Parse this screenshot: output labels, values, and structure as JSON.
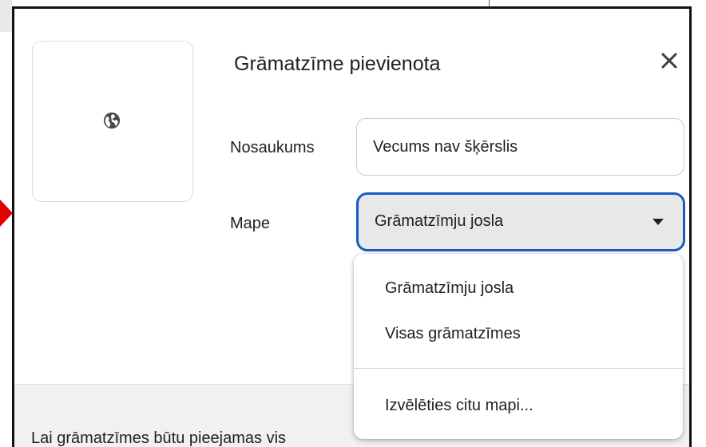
{
  "dialog": {
    "title": "Grāmatzīme pievienota",
    "close_icon": "close-icon",
    "thumbnail_icon": "globe-icon"
  },
  "form": {
    "name_label": "Nosaukums",
    "name_value": "Vecums nav šķērslis",
    "folder_label": "Mape",
    "folder_selected": "Grāmatzīmju josla",
    "folder_caret_icon": "caret-down-icon"
  },
  "folder_menu": {
    "items": [
      {
        "label": "Grāmatzīmju josla"
      },
      {
        "label": "Visas grāmatzīmes"
      }
    ],
    "choose_other": "Izvēlēties citu mapi..."
  },
  "footer": {
    "text": "Lai grāmatzīmes būtu pieejamas vis"
  },
  "colors": {
    "focus_ring": "#1a5bbf",
    "annotation_arrow": "#e30000",
    "footer_bg": "#f1f1f1"
  }
}
